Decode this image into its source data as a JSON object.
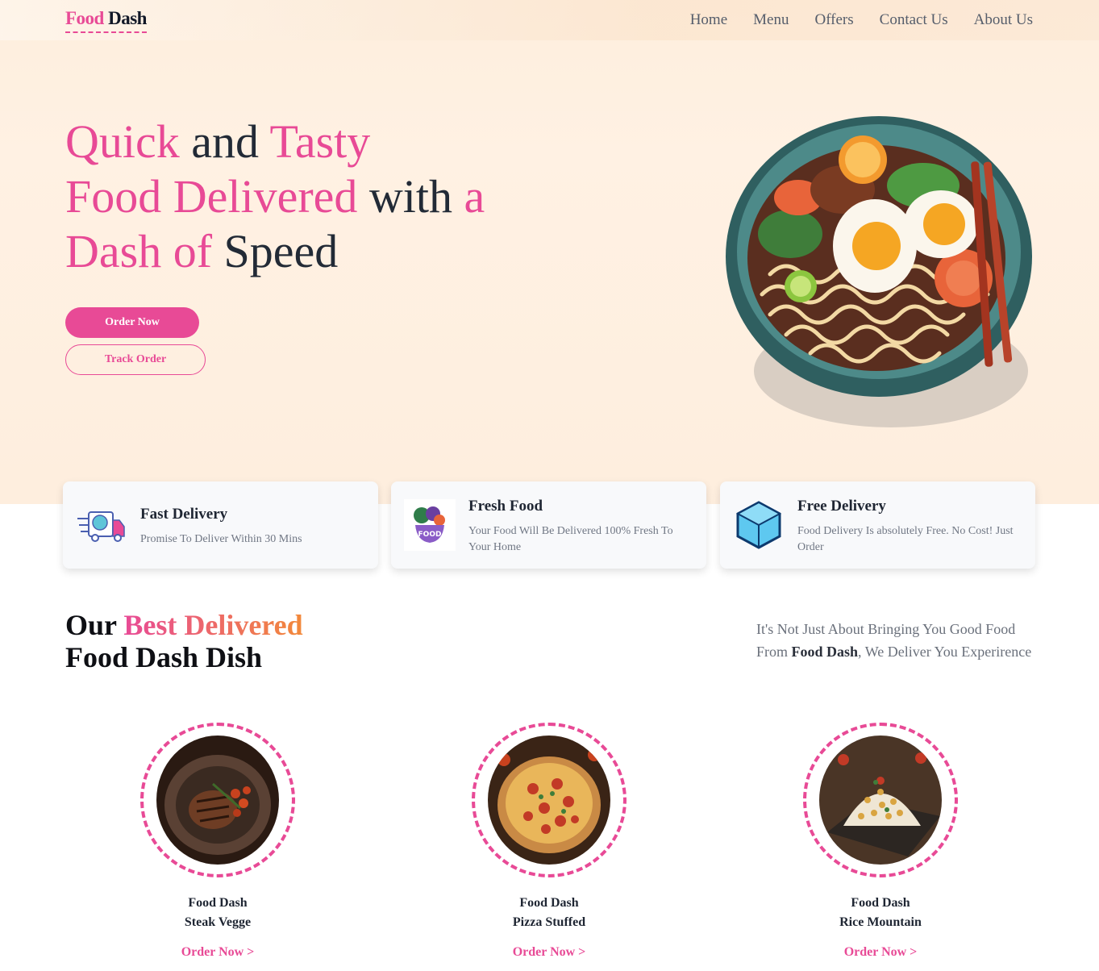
{
  "brand": {
    "part1": "Food",
    "part2": "Dash"
  },
  "nav": [
    "Home",
    "Menu",
    "Offers",
    "Contact Us",
    "About Us"
  ],
  "hero": {
    "w1": "Quick",
    "w2": "and",
    "w3": "Tasty",
    "w4": "Food Delivered",
    "w5": "with",
    "w6": "a",
    "w7": "Dash of",
    "w8": "Speed",
    "primary_button": "Order Now",
    "secondary_button": "Track Order"
  },
  "features": [
    {
      "title": "Fast Delivery",
      "desc": "Promise To Deliver Within 30 Mins",
      "icon": "delivery-truck-icon"
    },
    {
      "title": "Fresh Food",
      "desc": "Your Food Will Be Delivered 100% Fresh To Your Home",
      "icon": "fresh-food-icon"
    },
    {
      "title": "Free Delivery",
      "desc": "Food Delivery Is absolutely Free. No Cost! Just Order",
      "icon": "box-icon"
    }
  ],
  "section": {
    "t1": "Our",
    "t2": "Best Delivered",
    "t3": "Food Dash Dish",
    "sub1": "It's Not Just About Bringing You Good Food From",
    "sub_bold": "Food Dash",
    "sub2": ", We Deliver You Experirence"
  },
  "dishes": [
    {
      "line1": "Food Dash",
      "line2": "Steak Vegge",
      "link": "Order Now >"
    },
    {
      "line1": "Food Dash",
      "line2": "Pizza Stuffed",
      "link": "Order Now >"
    },
    {
      "line1": "Food Dash",
      "line2": "Rice Mountain",
      "link": "Order Now >"
    }
  ],
  "colors": {
    "accent": "#e84a96",
    "hero_bg": "#fdeedd",
    "accent_orange": "#f2893a"
  }
}
